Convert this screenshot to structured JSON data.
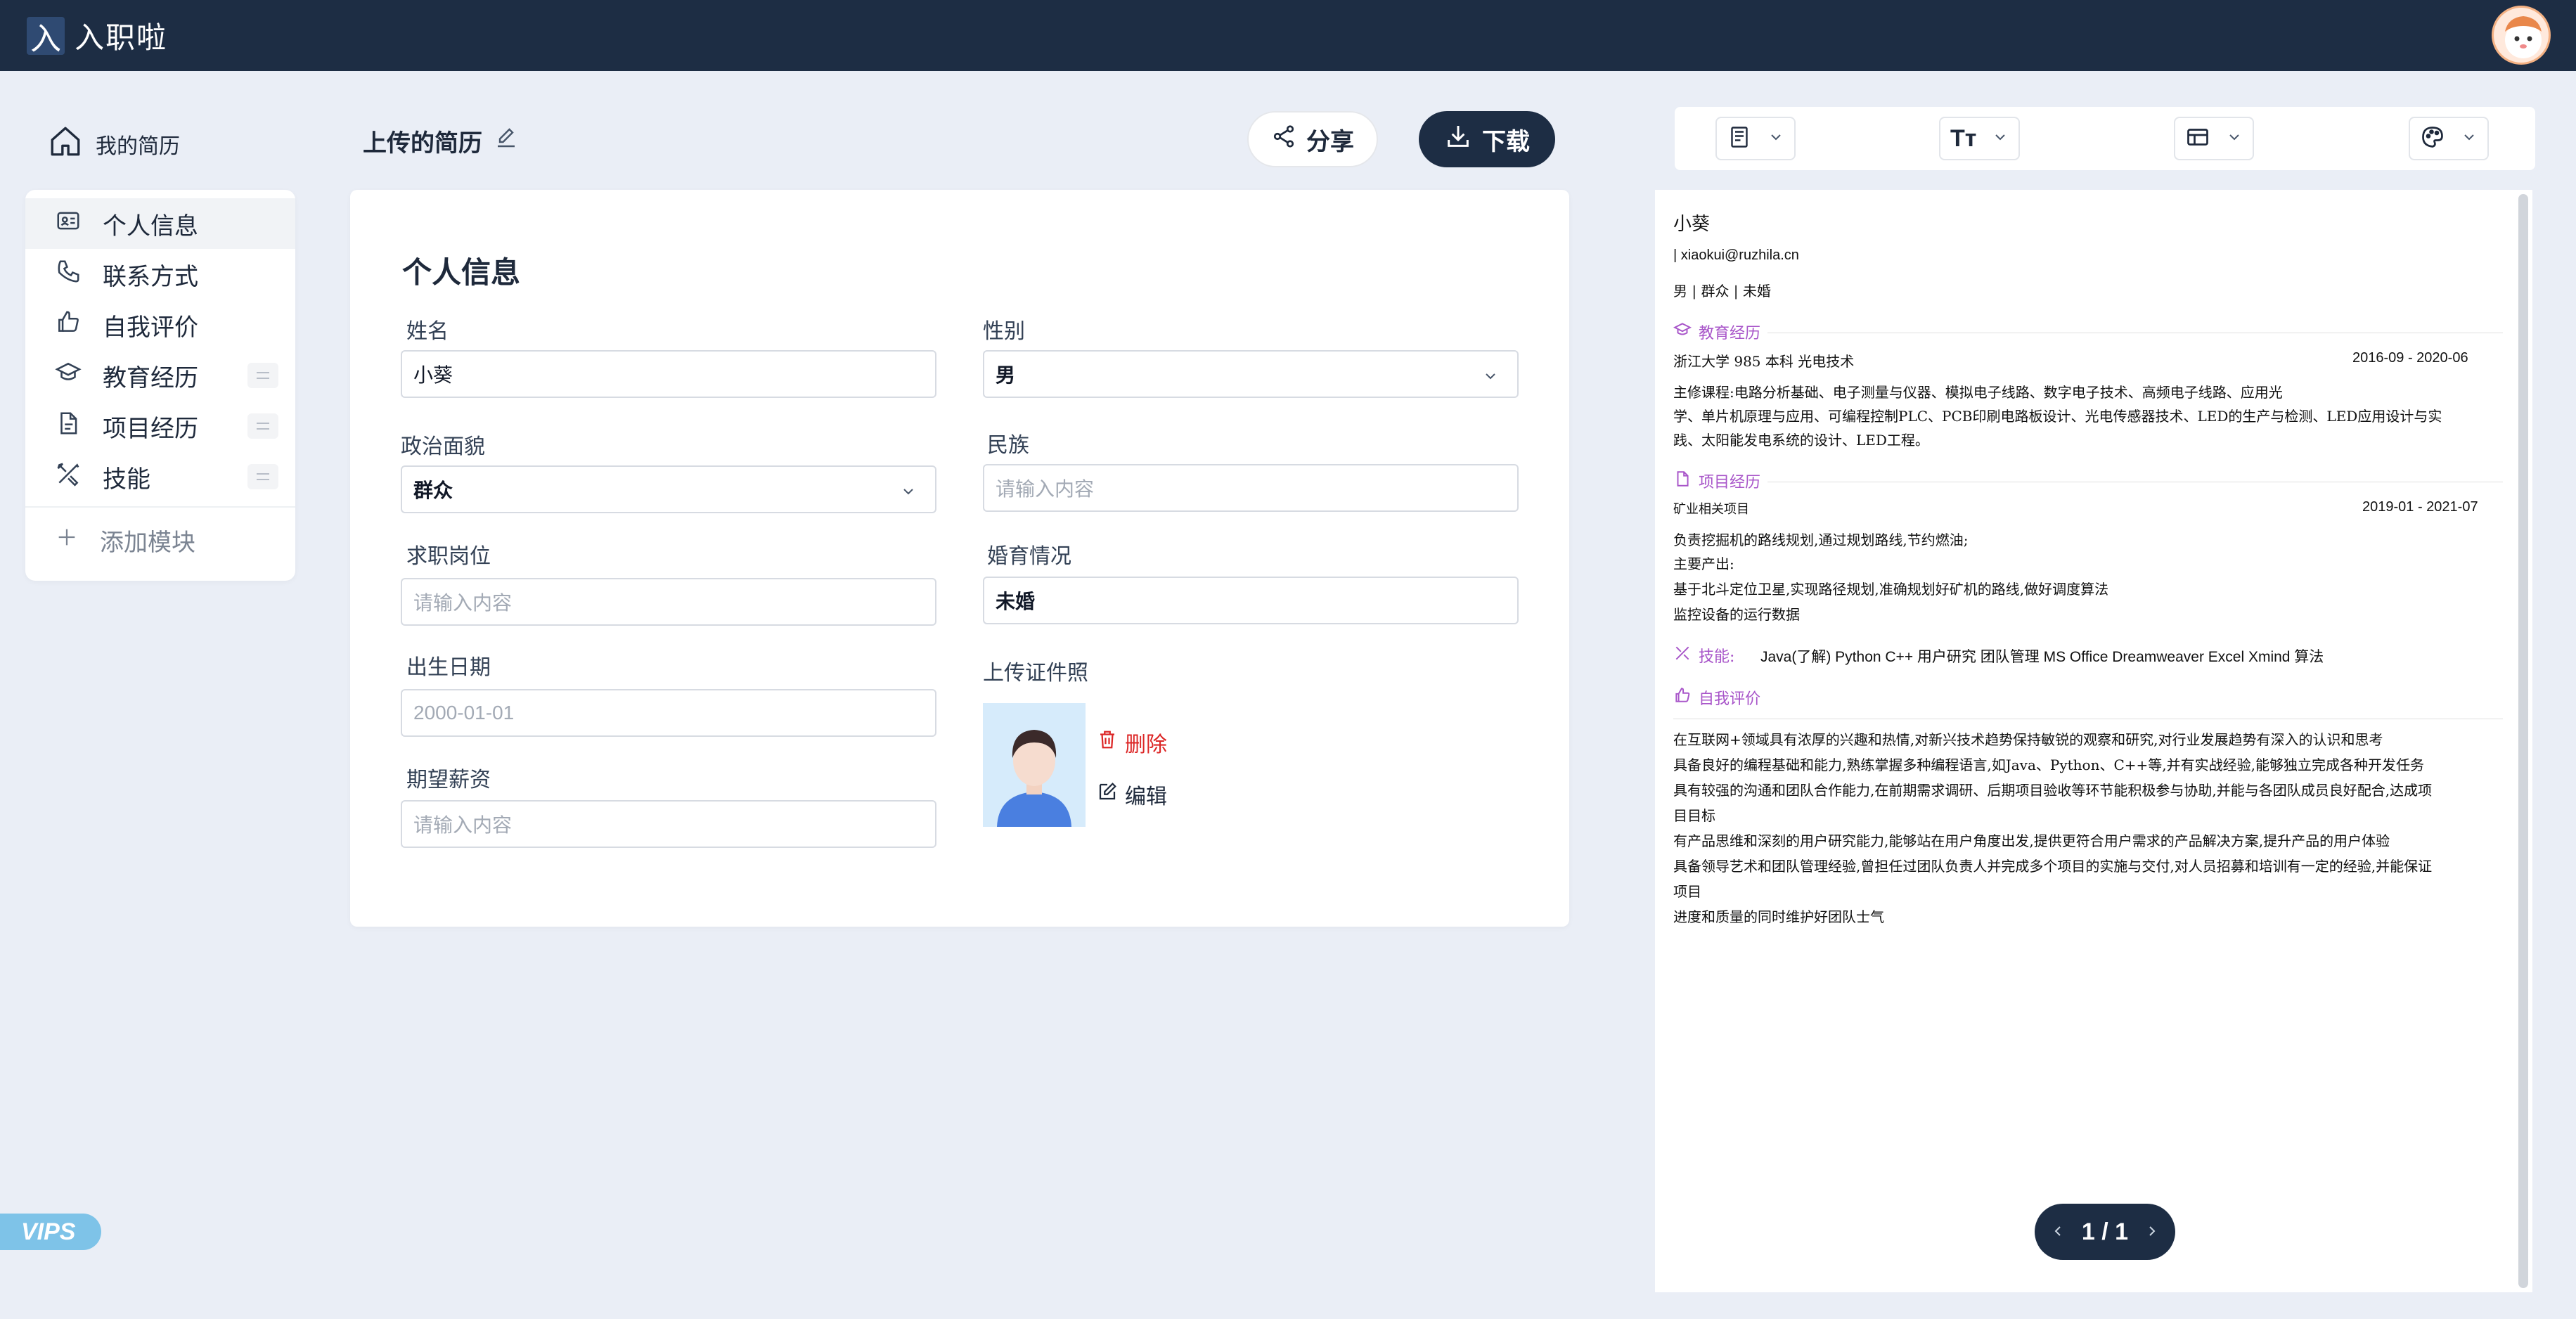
{
  "app": {
    "logo_glyph": "入",
    "name": "入职啦"
  },
  "sidebar": {
    "my_resume": "我的简历",
    "items": [
      {
        "label": "个人信息",
        "icon": "id-card-icon"
      },
      {
        "label": "联系方式",
        "icon": "phone-icon"
      },
      {
        "label": "自我评价",
        "icon": "thumbs-up-icon"
      },
      {
        "label": "教育经历",
        "icon": "graduation-cap-icon"
      },
      {
        "label": "项目经历",
        "icon": "document-icon"
      },
      {
        "label": "技能",
        "icon": "tools-icon"
      }
    ],
    "add_module": "添加模块",
    "vip_badge": "VIPS"
  },
  "header": {
    "title": "上传的简历",
    "share_label": "分享",
    "download_label": "下载"
  },
  "form": {
    "section_title": "个人信息",
    "name": {
      "label": "姓名",
      "value": "小葵"
    },
    "gender": {
      "label": "性别",
      "value": "男"
    },
    "political": {
      "label": "政治面貌",
      "value": "群众"
    },
    "ethnicity": {
      "label": "民族",
      "placeholder": "请输入内容"
    },
    "position": {
      "label": "求职岗位",
      "placeholder": "请输入内容"
    },
    "marital": {
      "label": "婚育情况",
      "value": "未婚"
    },
    "birthdate": {
      "label": "出生日期",
      "placeholder": "2000-01-01"
    },
    "salary": {
      "label": "期望薪资",
      "placeholder": "请输入内容"
    },
    "photo": {
      "label": "上传证件照",
      "delete_label": "删除",
      "edit_label": "编辑"
    }
  },
  "toolbar": {
    "font_glyph": "Tт"
  },
  "preview": {
    "name": "小葵",
    "email": "| xiaokui@ruzhila.cn",
    "meta": "男 | 群众 | 未婚",
    "education_title": "教育经历",
    "education_row": "浙江大学  985   本科   光电技术",
    "education_date": "2016-09 - 2020-06",
    "education_lines": [
      "主修课程:电路分析基础、电子测量与仪器、模拟电子线路、数字电子技术、高频电子线路、应用光",
      "学、单片机原理与应用、可编程控制PLC、PCB印刷电路板设计、光电传感器技术、LED的生产与检测、LED应用设计与实",
      "践、太阳能发电系统的设计、LED工程。"
    ],
    "project_title": "项目经历",
    "project_row": "矿业相关项目",
    "project_date": "2019-01 - 2021-07",
    "project_lines": [
      "负责挖掘机的路线规划,通过规划路线,节约燃油;",
      "主要产出:",
      "基于北斗定位卫星,实现路径规划,准确规划好矿机的路线,做好调度算法",
      "监控设备的运行数据"
    ],
    "skills_title": "技能:",
    "skills": "Java(了解)   Python   C++   用户研究   团队管理   MS Office   Dreamweaver   Excel   Xmind   算法",
    "self_title": "自我评价",
    "self_lines": [
      "在互联网+领域具有浓厚的兴趣和热情,对新兴技术趋势保持敏锐的观察和研究,对行业发展趋势有深入的认识和思考",
      "具备良好的编程基础和能力,熟练掌握多种编程语言,如Java、Python、C++等,并有实战经验,能够独立完成各种开发任务",
      "具有较强的沟通和团队合作能力,在前期需求调研、后期项目验收等环节能积极参与协助,并能与各团队成员良好配合,达成项",
      "目目标",
      "有产品思维和深刻的用户研究能力,能够站在用户角度出发,提供更符合用户需求的产品解决方案,提升产品的用户体验",
      "具备领导艺术和团队管理经验,曾担任过团队负责人并完成多个项目的实施与交付,对人员招募和培训有一定的经验,并能保证",
      "项目",
      "进度和质量的同时维护好团队士气"
    ]
  },
  "pager": {
    "text": "1 / 1"
  }
}
